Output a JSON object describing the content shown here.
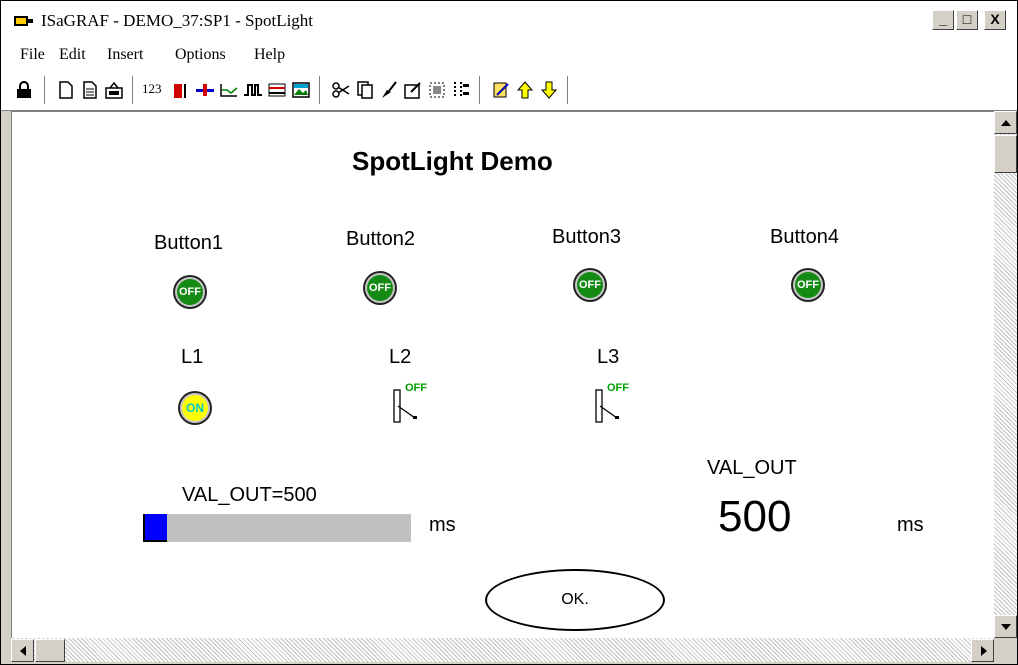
{
  "window": {
    "title": "ISaGRAF - DEMO_37:SP1 - SpotLight",
    "minimize": "_",
    "maximize": "□",
    "close": "X"
  },
  "menu": [
    "File",
    "Edit",
    "Insert",
    "Options",
    "Help"
  ],
  "toolbar": {
    "number_label": "123",
    "icons": [
      "lock-icon",
      "new-file-icon",
      "document-icon",
      "open-icon",
      "numeric-icon",
      "bar-icon",
      "slider-icon",
      "trend-icon",
      "switch-icon",
      "grid-icon",
      "image-icon",
      "cut-icon",
      "copy-icon",
      "paint-icon",
      "properties-icon",
      "select-icon",
      "align-icon",
      "edit-icon",
      "up-arrow-icon",
      "down-arrow-icon"
    ]
  },
  "panel": {
    "heading": "SpotLight Demo",
    "buttons": [
      {
        "label": "Button1",
        "state": "OFF"
      },
      {
        "label": "Button2",
        "state": "OFF"
      },
      {
        "label": "Button3",
        "state": "OFF"
      },
      {
        "label": "Button4",
        "state": "OFF"
      }
    ],
    "lamps": [
      {
        "label": "L1",
        "state": "ON"
      },
      {
        "label": "L2",
        "state": "OFF"
      },
      {
        "label": "L3",
        "state": "OFF"
      }
    ],
    "bar_label": "VAL_OUT=500",
    "bar_unit": "ms",
    "bar_fill_fraction": 0.09,
    "value_label": "VAL_OUT",
    "value": "500",
    "value_unit": "ms",
    "ok_label": "OK."
  },
  "colors": {
    "button_green": "#148a14",
    "lamp_on_yellow": "#ffff00",
    "lamp_on_text": "#00c8c8",
    "bar_blue": "#0000ff",
    "switch_text": "#00a000"
  }
}
